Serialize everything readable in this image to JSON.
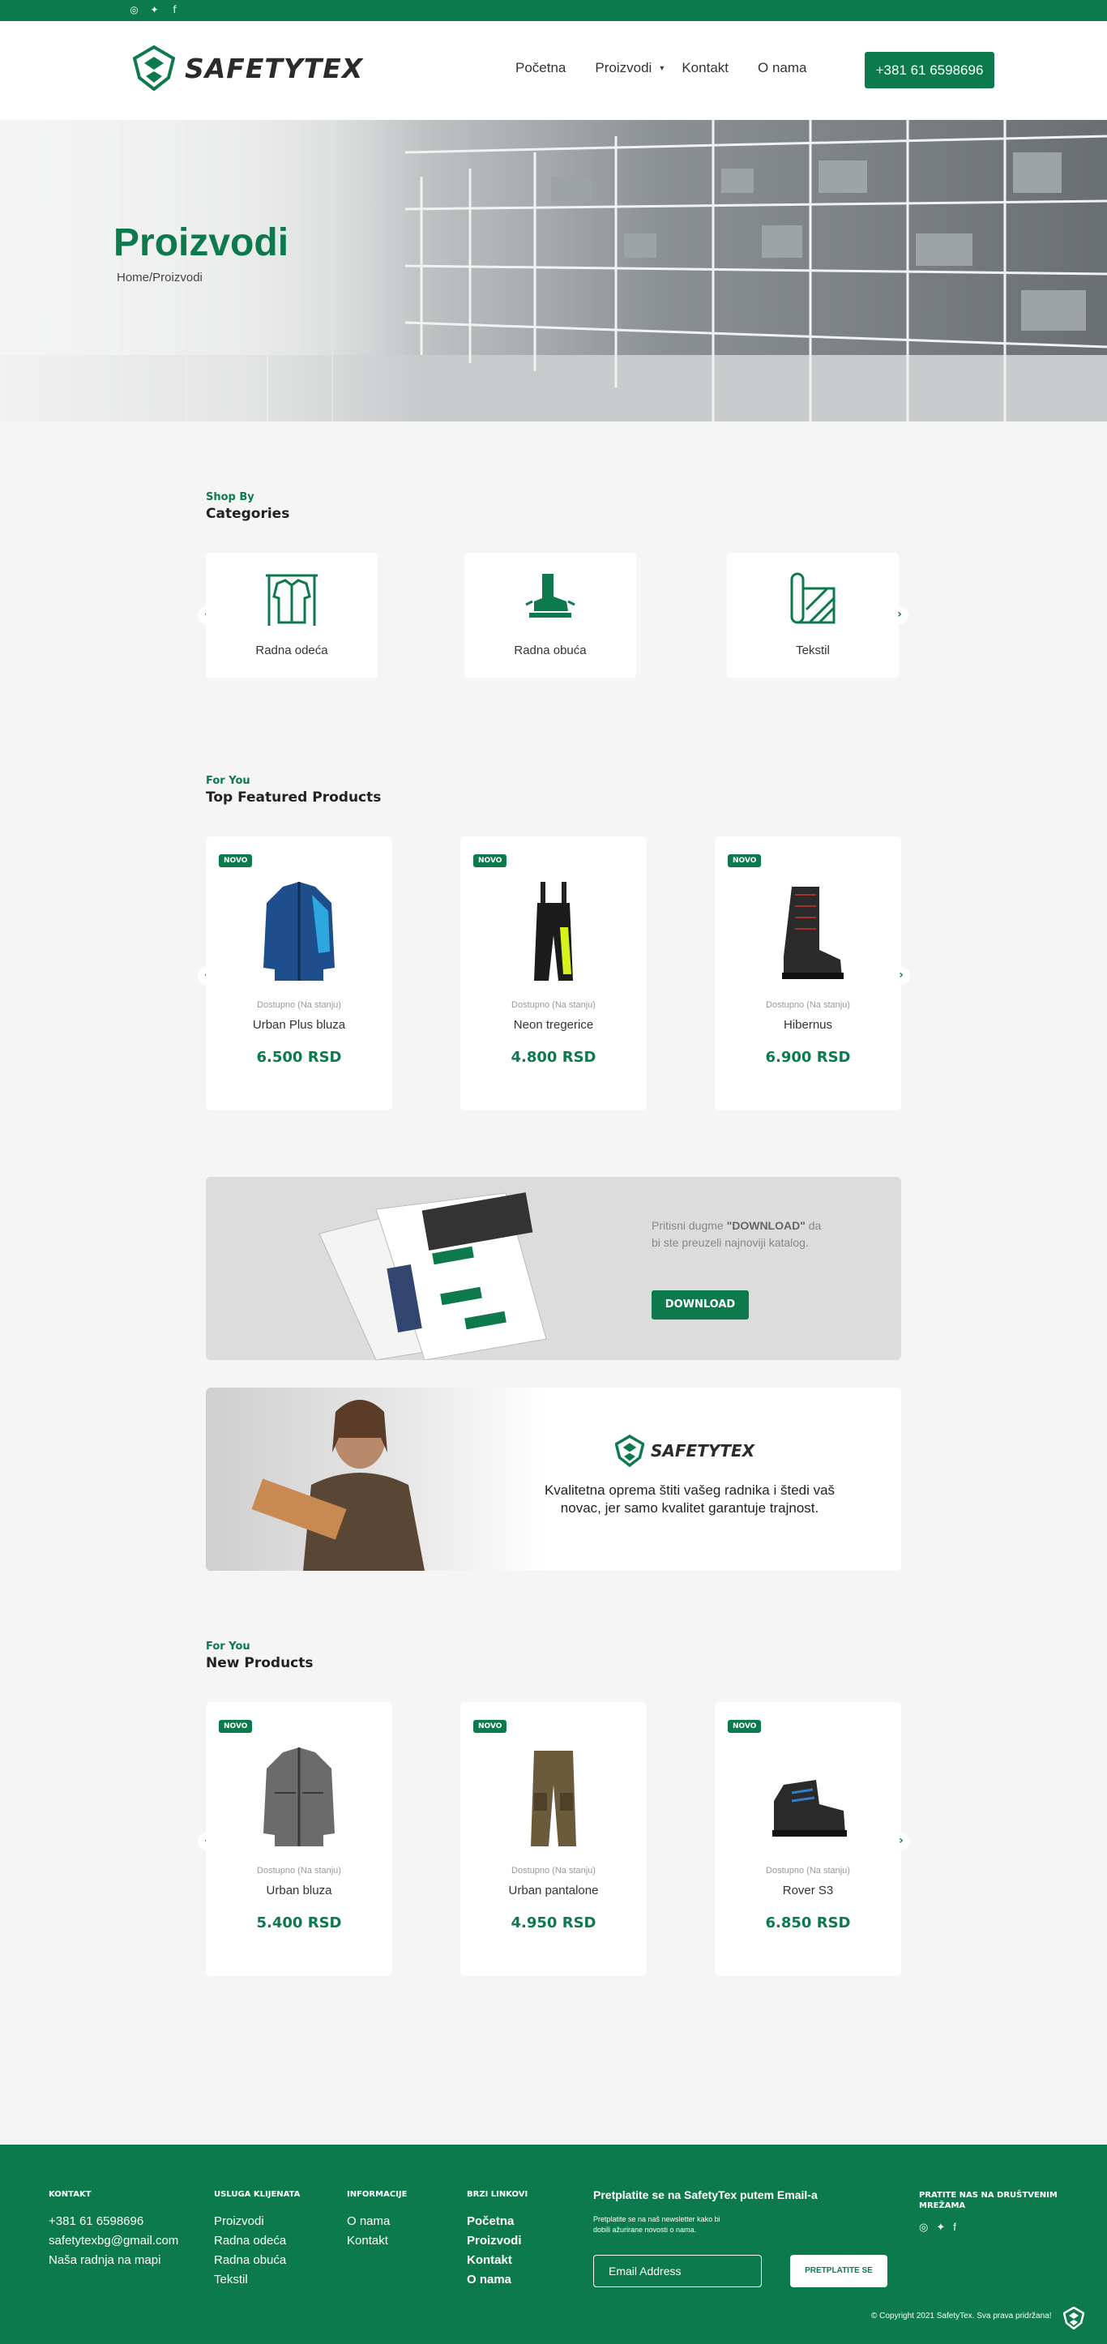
{
  "social": {
    "instagram_icon": "instagram-icon",
    "twitter_icon": "twitter-icon",
    "facebook_icon": "facebook-icon"
  },
  "header": {
    "logo_text": "SAFETYTEX",
    "nav": [
      {
        "label": "Početna"
      },
      {
        "label": "Proizvodi"
      },
      {
        "label": "Kontakt"
      },
      {
        "label": "O nama"
      }
    ],
    "phone": "+381 61 6598696"
  },
  "hero": {
    "title": "Proizvodi",
    "breadcrumb": "Home/Proizvodi"
  },
  "categories": {
    "kicker": "Shop By",
    "title": "Categories",
    "items": [
      {
        "label": "Radna odeća"
      },
      {
        "label": "Radna obuća"
      },
      {
        "label": "Tekstil"
      }
    ]
  },
  "featured": {
    "kicker": "For You",
    "title": "Top Featured Products",
    "products": [
      {
        "badge": "NOVO",
        "stock": "Dostupno (Na stanju)",
        "name": "Urban Plus bluza",
        "price": "6.500 RSD"
      },
      {
        "badge": "NOVO",
        "stock": "Dostupno (Na stanju)",
        "name": "Neon tregerice",
        "price": "4.800 RSD"
      },
      {
        "badge": "NOVO",
        "stock": "Dostupno (Na stanju)",
        "name": "Hibernus",
        "price": "6.900 RSD"
      }
    ]
  },
  "download": {
    "text_pre": "Pritisni dugme ",
    "text_bold": "\"DOWNLOAD\"",
    "text_post": " da bi ste preuzeli najnoviji katalog.",
    "button": "DOWNLOAD"
  },
  "promo": {
    "logo_text": "SAFETYTEX",
    "text": "Kvalitetna oprema štiti vašeg radnika i štedi vaš novac, jer samo kvalitet garantuje trajnost."
  },
  "new_products": {
    "kicker": "For You",
    "title": "New Products",
    "products": [
      {
        "badge": "NOVO",
        "stock": "Dostupno (Na stanju)",
        "name": "Urban bluza",
        "price": "5.400 RSD"
      },
      {
        "badge": "NOVO",
        "stock": "Dostupno (Na stanju)",
        "name": "Urban pantalone",
        "price": "4.950 RSD"
      },
      {
        "badge": "NOVO",
        "stock": "Dostupno (Na stanju)",
        "name": "Rover S3",
        "price": "6.850 RSD"
      }
    ]
  },
  "footer": {
    "kontakt": {
      "heading": "KONTAKT",
      "phone": "+381 61 6598696",
      "email": "safetytexbg@gmail.com",
      "map": "Naša radnja na mapi"
    },
    "usluga": {
      "heading": "USLUGA KLIJENATA",
      "links": [
        "Proizvodi",
        "Radna odeća",
        "Radna obuća",
        "Tekstil"
      ]
    },
    "informacije": {
      "heading": "INFORMACIJE",
      "links": [
        "O nama",
        "Kontakt"
      ]
    },
    "brzi": {
      "heading": "BRZI LINKOVI",
      "links": [
        "Početna",
        "Proizvodi",
        "Kontakt",
        "O nama"
      ]
    },
    "newsletter": {
      "title": "Pretplatite se na SafetyTex putem Email-a",
      "subtitle": "Pretplatite se na naš newsletter kako bi dobili ažurirane novosti o nama.",
      "placeholder": "Email Address",
      "button": "PRETPLATITE SE"
    },
    "social_title": "PRATITE NAS NA DRUŠTVENIM MREŽAMA",
    "copyright": "© Copyright 2021 SafetyTex. Sva prava pridržana!"
  },
  "colors": {
    "brand": "#0d7a4e",
    "background": "#f5f5f5"
  }
}
